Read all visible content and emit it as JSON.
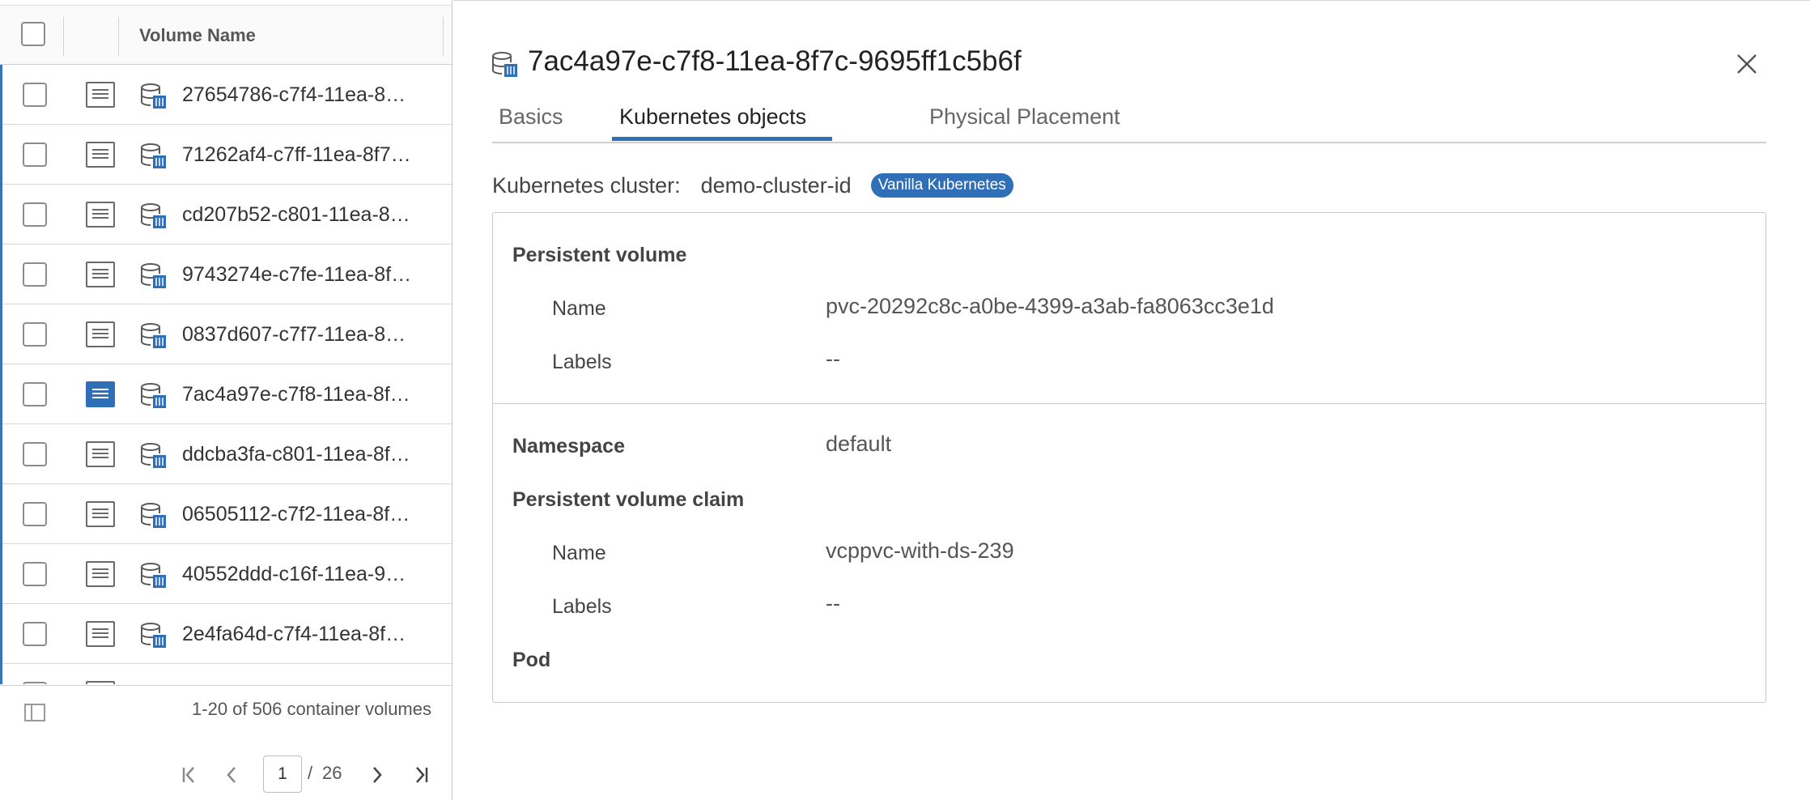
{
  "grid": {
    "column_header": "Volume Name",
    "rows": [
      {
        "name": "27654786-c7f4-11ea-8…",
        "selected": false
      },
      {
        "name": "71262af4-c7ff-11ea-8f7…",
        "selected": false
      },
      {
        "name": "cd207b52-c801-11ea-8…",
        "selected": false
      },
      {
        "name": "9743274e-c7fe-11ea-8f…",
        "selected": false
      },
      {
        "name": "0837d607-c7f7-11ea-8…",
        "selected": false
      },
      {
        "name": "7ac4a97e-c7f8-11ea-8f…",
        "selected": true
      },
      {
        "name": "ddcba3fa-c801-11ea-8f…",
        "selected": false
      },
      {
        "name": "06505112-c7f2-11ea-8f…",
        "selected": false
      },
      {
        "name": "40552ddd-c16f-11ea-9…",
        "selected": false
      },
      {
        "name": "2e4fa64d-c7f4-11ea-8f…",
        "selected": false
      }
    ],
    "footer": {
      "summary": "1-20 of 506 container volumes",
      "current_page": "1",
      "separator": "/",
      "total_pages": "26"
    }
  },
  "panel": {
    "title": "7ac4a97e-c7f8-11ea-8f7c-9695ff1c5b6f",
    "tabs": [
      "Basics",
      "Kubernetes objects",
      "Physical Placement"
    ],
    "active_tab": "Kubernetes objects",
    "cluster_label": "Kubernetes cluster:",
    "cluster_value": "demo-cluster-id",
    "cluster_badge": "Vanilla Kubernetes",
    "persistent_volume": {
      "heading": "Persistent volume",
      "name_label": "Name",
      "name_value": "pvc-20292c8c-a0be-4399-a3ab-fa8063cc3e1d",
      "labels_label": "Labels",
      "labels_value": "--"
    },
    "namespace": {
      "label": "Namespace",
      "value": "default"
    },
    "pvc": {
      "heading": "Persistent volume claim",
      "name_label": "Name",
      "name_value": "vcppvc-with-ds-239",
      "labels_label": "Labels",
      "labels_value": "--"
    },
    "pod": {
      "heading": "Pod"
    }
  },
  "colors": {
    "accent": "#2f6fb7",
    "border": "#c9c9c9",
    "text": "#333333"
  },
  "icons": [
    "volume-icon",
    "detail-toggle-icon",
    "close-icon",
    "column-toggle-icon",
    "first-page-icon",
    "prev-page-icon",
    "next-page-icon",
    "last-page-icon"
  ]
}
